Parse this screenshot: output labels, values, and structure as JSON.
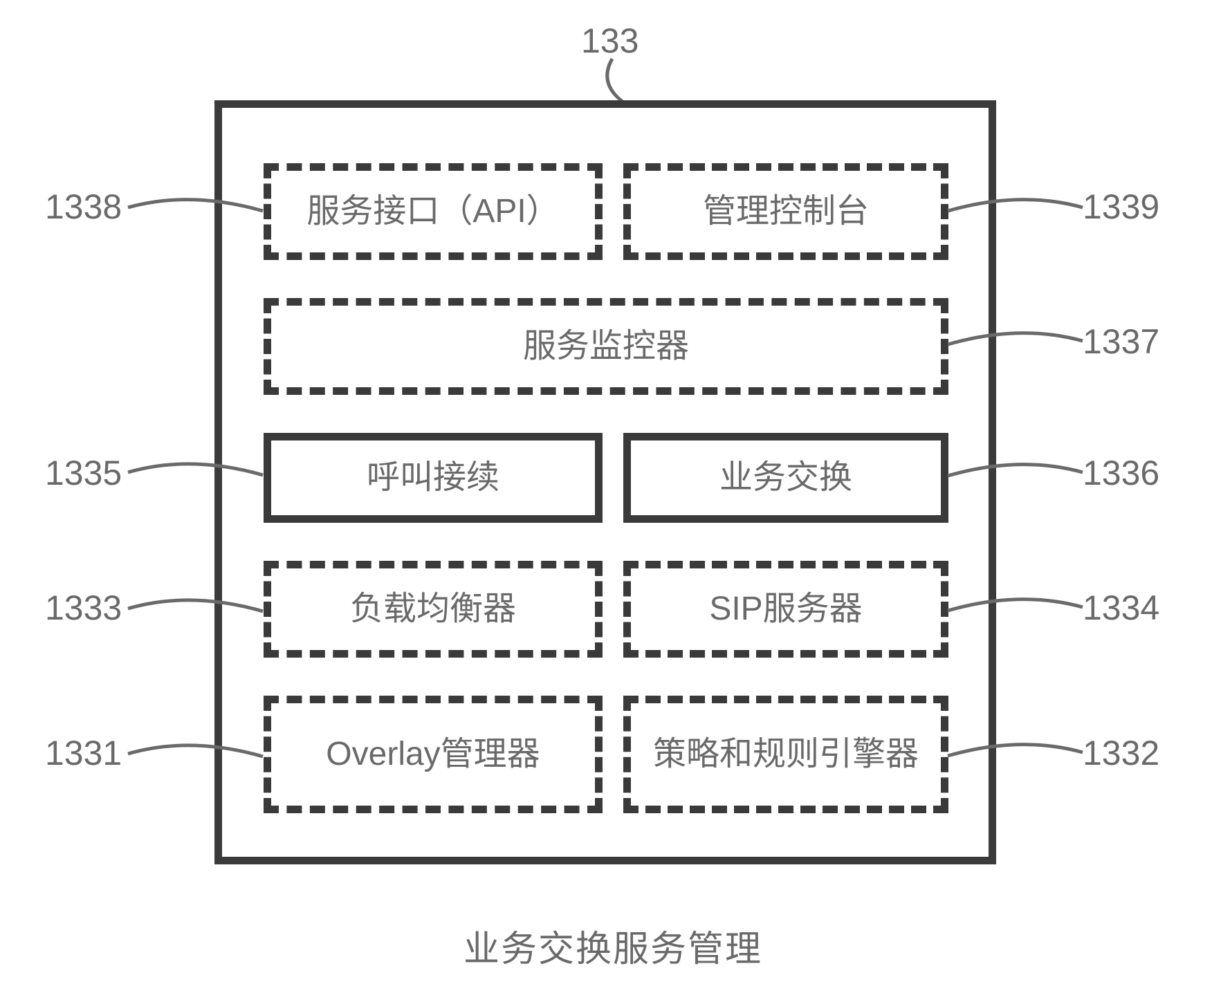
{
  "refs": {
    "top": "133",
    "r1l": "1338",
    "r1r": "1339",
    "r2r": "1337",
    "r3l": "1335",
    "r3r": "1336",
    "r4l": "1333",
    "r4r": "1334",
    "r5l": "1331",
    "r5r": "1332"
  },
  "boxes": {
    "api": "服务接口（API）",
    "console": "管理控制台",
    "monitor": "服务监控器",
    "call": "呼叫接续",
    "switch": "业务交换",
    "lb": "负载均衡器",
    "sip": "SIP服务器",
    "overlay": "Overlay管理器",
    "policy": "策略和规则引擎器"
  },
  "caption": "业务交换服务管理"
}
